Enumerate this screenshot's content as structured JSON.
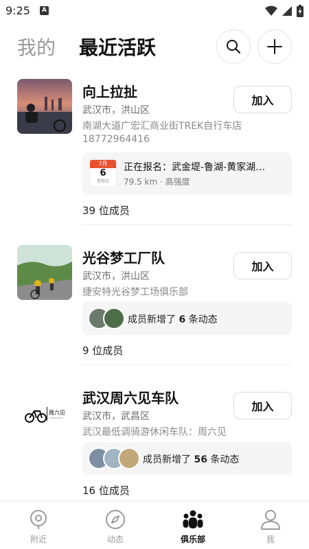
{
  "status_bar": {
    "time": "9:25",
    "notif_letter": "A"
  },
  "header": {
    "tab_mine": "我的",
    "tab_recent": "最近活跃"
  },
  "clubs": [
    {
      "name": "向上拉扯",
      "location": "武汉市，洪山区",
      "description": "南湖大道广宏汇商业街TREK自行车店",
      "phone": "18772964416",
      "join_label": "加入",
      "event": {
        "month": "7月",
        "day": "6",
        "weekday": "星期日",
        "title": "正在报名：武金堤-鲁湖-黄家湖…",
        "meta": "79.5 km · 高强度"
      },
      "members": "39 位成员"
    },
    {
      "name": "光谷梦工厂队",
      "location": "武汉市，洪山区",
      "description": "捷安特光谷梦工场俱乐部",
      "join_label": "加入",
      "update": {
        "prefix": "成员新增了 ",
        "count": "6",
        "suffix": " 条动态"
      },
      "members": "9 位成员"
    },
    {
      "name": "武汉周六见车队",
      "location": "武汉市，武昌区",
      "description": "武汉最低调骑游休闲车队：周六见",
      "join_label": "加入",
      "logo_text": "周六见",
      "update": {
        "prefix": "成员新增了 ",
        "count": "56",
        "suffix": " 条动态"
      },
      "members": "16 位成员"
    }
  ],
  "bottom_nav": [
    {
      "label": "附近",
      "icon": "location-pin-icon",
      "active": false
    },
    {
      "label": "动态",
      "icon": "compass-icon",
      "active": false
    },
    {
      "label": "俱乐部",
      "icon": "group-icon",
      "active": true
    },
    {
      "label": "我",
      "icon": "person-icon",
      "active": false
    }
  ],
  "colors": {
    "calendar_red": "#e8502f",
    "muted_text": "#8a8a8a",
    "active_nav": "#111111"
  }
}
